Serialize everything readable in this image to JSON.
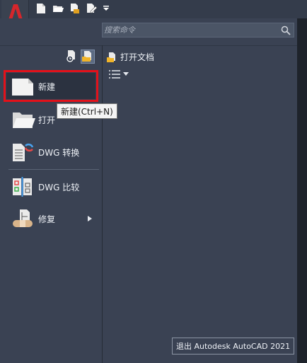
{
  "app": {
    "logo_letter": "A"
  },
  "search": {
    "placeholder": "搜索命令"
  },
  "quick_access": [
    "new-file-icon",
    "open-folder-icon",
    "save-icon",
    "save-as-icon",
    "chevron-down-icon"
  ],
  "left_menu": {
    "items": [
      {
        "label": "新建",
        "icon": "new-document-icon"
      },
      {
        "label": "打开",
        "icon": "open-folder-icon"
      },
      {
        "label": "DWG 转换",
        "icon": "dwg-convert-icon"
      },
      {
        "label": "DWG 比较",
        "icon": "dwg-compare-icon"
      },
      {
        "label": "修复",
        "icon": "repair-icon"
      }
    ]
  },
  "tooltip": {
    "text": "新建(Ctrl+N)"
  },
  "recent": {
    "title": "打开文档"
  },
  "footer": {
    "exit_label": "退出 Autodesk AutoCAD 2021"
  },
  "colors": {
    "accent_red": "#e3111a",
    "panel": "#3a4253",
    "tooltip_bg": "#f4f4f4"
  }
}
